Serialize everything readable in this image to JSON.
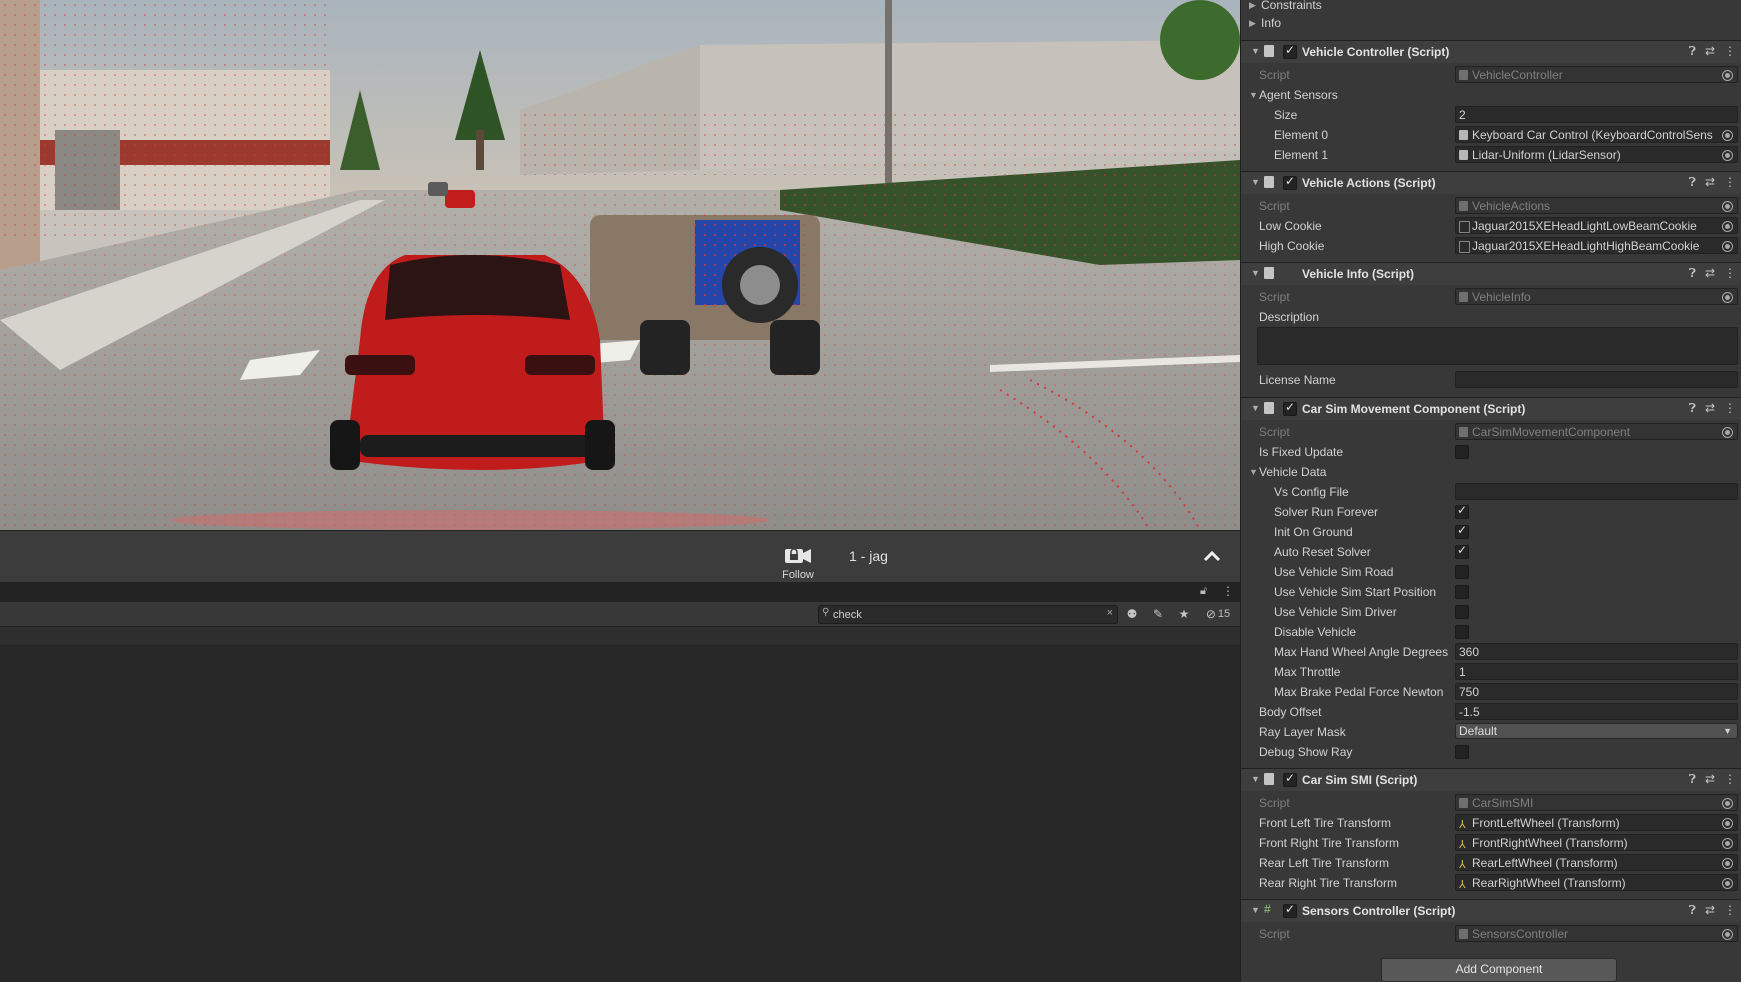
{
  "scene": {
    "description_colors": {
      "sky": "#bdbfbf",
      "road": "#9e9d9a",
      "building": "#c9c5bf",
      "car_red": "#c21d1d",
      "jeep": "#8a7866",
      "bushes": "#2f4a26"
    }
  },
  "followbar": {
    "follow_label": "Follow",
    "vehicle_name": "1 - jag"
  },
  "bottom_panel": {
    "search_value": "check",
    "hidden_count": "15"
  },
  "inspector": {
    "top_rows": [
      {
        "label": "Constraints"
      },
      {
        "label": "Info"
      }
    ],
    "vehicle_controller": {
      "title": "Vehicle Controller (Script)",
      "script_label": "Script",
      "script_value": "VehicleController",
      "agent_sensors_label": "Agent Sensors",
      "size_label": "Size",
      "size_value": "2",
      "element0_label": "Element 0",
      "element0_value": "Keyboard Car Control (KeyboardControlSens",
      "element1_label": "Element 1",
      "element1_value": "Lidar-Uniform (LidarSensor)"
    },
    "vehicle_actions": {
      "title": "Vehicle Actions (Script)",
      "script_label": "Script",
      "script_value": "VehicleActions",
      "low_cookie_label": "Low Cookie",
      "low_cookie_value": "Jaguar2015XEHeadLightLowBeamCookie",
      "high_cookie_label": "High Cookie",
      "high_cookie_value": "Jaguar2015XEHeadLightHighBeamCookie"
    },
    "vehicle_info": {
      "title": "Vehicle Info (Script)",
      "script_label": "Script",
      "script_value": "VehicleInfo",
      "description_label": "Description",
      "license_label": "License Name"
    },
    "car_sim_movement": {
      "title": "Car Sim Movement Component (Script)",
      "script_label": "Script",
      "script_value": "CarSimMovementComponent",
      "is_fixed_update_label": "Is Fixed Update",
      "vehicle_data_label": "Vehicle Data",
      "vs_config_label": "Vs Config File",
      "solver_run_forever_label": "Solver Run Forever",
      "init_on_ground_label": "Init On Ground",
      "auto_reset_solver_label": "Auto Reset Solver",
      "use_vs_road_label": "Use Vehicle Sim Road",
      "use_vs_start_label": "Use Vehicle Sim Start Position",
      "use_vs_driver_label": "Use Vehicle Sim Driver",
      "disable_vehicle_label": "Disable Vehicle",
      "max_hand_wheel_label": "Max Hand Wheel Angle Degrees",
      "max_hand_wheel_value": "360",
      "max_throttle_label": "Max Throttle",
      "max_throttle_value": "1",
      "max_brake_label": "Max Brake Pedal Force Newton",
      "max_brake_value": "750",
      "body_offset_label": "Body Offset",
      "body_offset_value": "-1.5",
      "ray_layer_label": "Ray Layer Mask",
      "ray_layer_value": "Default",
      "debug_show_ray_label": "Debug Show Ray"
    },
    "car_sim_smi": {
      "title": "Car Sim SMI (Script)",
      "script_label": "Script",
      "script_value": "CarSimSMI",
      "fl_label": "Front Left Tire Transform",
      "fl_value": "FrontLeftWheel (Transform)",
      "fr_label": "Front Right Tire Transform",
      "fr_value": "FrontRightWheel (Transform)",
      "rl_label": "Rear Left Tire Transform",
      "rl_value": "RearLeftWheel (Transform)",
      "rr_label": "Rear Right Tire Transform",
      "rr_value": "RearRightWheel (Transform)"
    },
    "sensors_controller": {
      "title": "Sensors Controller (Script)",
      "script_label": "Script",
      "script_value": "SensorsController"
    },
    "add_component_label": "Add Component"
  }
}
